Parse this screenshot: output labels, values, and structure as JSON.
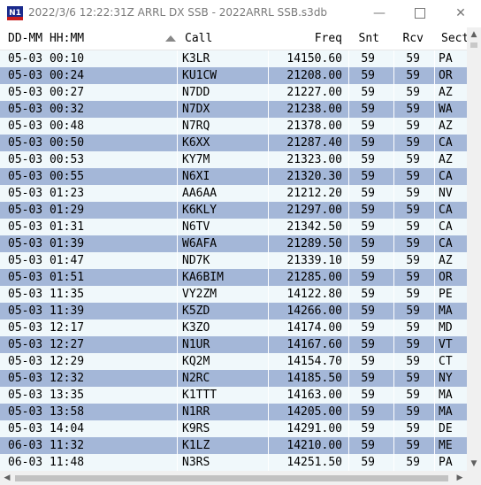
{
  "window": {
    "title": "2022/3/6 12:22:31Z  ARRL DX SSB - 2022ARRL SSB.s3db",
    "icon_text": "N1",
    "minimize_glyph": "—",
    "close_glyph": "✕"
  },
  "columns": {
    "datetime": "DD-MM HH:MM",
    "call": "Call",
    "freq": "Freq",
    "snt": "Snt",
    "rcv": "Rcv",
    "sect": "Sect"
  },
  "sort": {
    "column": "call",
    "direction": "ascending"
  },
  "colors": {
    "row_alt": "#a4b7d8",
    "row_base": "#f0f8fb"
  },
  "rows": [
    {
      "dt": "05-03 00:10",
      "call": "K3LR",
      "freq": "14150.60",
      "snt": "59",
      "rcv": "59",
      "sect": "PA"
    },
    {
      "dt": "05-03 00:24",
      "call": "KU1CW",
      "freq": "21208.00",
      "snt": "59",
      "rcv": "59",
      "sect": "OR"
    },
    {
      "dt": "05-03 00:27",
      "call": "N7DD",
      "freq": "21227.00",
      "snt": "59",
      "rcv": "59",
      "sect": "AZ"
    },
    {
      "dt": "05-03 00:32",
      "call": "N7DX",
      "freq": "21238.00",
      "snt": "59",
      "rcv": "59",
      "sect": "WA"
    },
    {
      "dt": "05-03 00:48",
      "call": "N7RQ",
      "freq": "21378.00",
      "snt": "59",
      "rcv": "59",
      "sect": "AZ"
    },
    {
      "dt": "05-03 00:50",
      "call": "K6XX",
      "freq": "21287.40",
      "snt": "59",
      "rcv": "59",
      "sect": "CA"
    },
    {
      "dt": "05-03 00:53",
      "call": "KY7M",
      "freq": "21323.00",
      "snt": "59",
      "rcv": "59",
      "sect": "AZ"
    },
    {
      "dt": "05-03 00:55",
      "call": "N6XI",
      "freq": "21320.30",
      "snt": "59",
      "rcv": "59",
      "sect": "CA"
    },
    {
      "dt": "05-03 01:23",
      "call": "AA6AA",
      "freq": "21212.20",
      "snt": "59",
      "rcv": "59",
      "sect": "NV"
    },
    {
      "dt": "05-03 01:29",
      "call": "K6KLY",
      "freq": "21297.00",
      "snt": "59",
      "rcv": "59",
      "sect": "CA"
    },
    {
      "dt": "05-03 01:31",
      "call": "N6TV",
      "freq": "21342.50",
      "snt": "59",
      "rcv": "59",
      "sect": "CA"
    },
    {
      "dt": "05-03 01:39",
      "call": "W6AFA",
      "freq": "21289.50",
      "snt": "59",
      "rcv": "59",
      "sect": "CA"
    },
    {
      "dt": "05-03 01:47",
      "call": "ND7K",
      "freq": "21339.10",
      "snt": "59",
      "rcv": "59",
      "sect": "AZ"
    },
    {
      "dt": "05-03 01:51",
      "call": "KA6BIM",
      "freq": "21285.00",
      "snt": "59",
      "rcv": "59",
      "sect": "OR"
    },
    {
      "dt": "05-03 11:35",
      "call": "VY2ZM",
      "freq": "14122.80",
      "snt": "59",
      "rcv": "59",
      "sect": "PE"
    },
    {
      "dt": "05-03 11:39",
      "call": "K5ZD",
      "freq": "14266.00",
      "snt": "59",
      "rcv": "59",
      "sect": "MA"
    },
    {
      "dt": "05-03 12:17",
      "call": "K3ZO",
      "freq": "14174.00",
      "snt": "59",
      "rcv": "59",
      "sect": "MD"
    },
    {
      "dt": "05-03 12:27",
      "call": "N1UR",
      "freq": "14167.60",
      "snt": "59",
      "rcv": "59",
      "sect": "VT"
    },
    {
      "dt": "05-03 12:29",
      "call": "KQ2M",
      "freq": "14154.70",
      "snt": "59",
      "rcv": "59",
      "sect": "CT"
    },
    {
      "dt": "05-03 12:32",
      "call": "N2RC",
      "freq": "14185.50",
      "snt": "59",
      "rcv": "59",
      "sect": "NY"
    },
    {
      "dt": "05-03 13:35",
      "call": "K1TTT",
      "freq": "14163.00",
      "snt": "59",
      "rcv": "59",
      "sect": "MA"
    },
    {
      "dt": "05-03 13:58",
      "call": "N1RR",
      "freq": "14205.00",
      "snt": "59",
      "rcv": "59",
      "sect": "MA"
    },
    {
      "dt": "05-03 14:04",
      "call": "K9RS",
      "freq": "14291.00",
      "snt": "59",
      "rcv": "59",
      "sect": "DE"
    },
    {
      "dt": "06-03 11:32",
      "call": "K1LZ",
      "freq": "14210.00",
      "snt": "59",
      "rcv": "59",
      "sect": "ME"
    },
    {
      "dt": "06-03 11:48",
      "call": "N3RS",
      "freq": "14251.50",
      "snt": "59",
      "rcv": "59",
      "sect": "PA"
    }
  ]
}
